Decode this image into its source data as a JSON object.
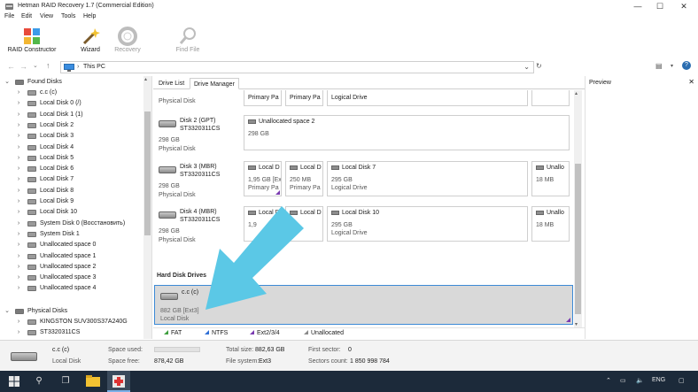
{
  "window": {
    "title": "Hetman RAID Recovery 1.7 (Commercial Edition)",
    "controls": [
      "—",
      "☐",
      "✕"
    ]
  },
  "menu": [
    "File",
    "Edit",
    "View",
    "Tools",
    "Help"
  ],
  "toolbar": {
    "raid_constructor": "RAID Constructor",
    "wizard": "Wizard",
    "recovery": "Recovery",
    "find_file": "Find File"
  },
  "address": {
    "path": "This PC"
  },
  "tree": {
    "found_disks_label": "Found Disks",
    "found_disks": [
      "c.c (c)",
      "Local Disk 0 (/)",
      "Local Disk 1 (1)",
      "Local Disk 2",
      "Local Disk 3",
      "Local Disk 4",
      "Local Disk 5",
      "Local Disk 6",
      "Local Disk 7",
      "Local Disk 8",
      "Local Disk 9",
      "Local Disk 10",
      "System Disk 0 (Восстановить)",
      "System Disk 1",
      "Unallocated space 0",
      "Unallocated space 1",
      "Unallocated space 2",
      "Unallocated space 3",
      "Unallocated space 4"
    ],
    "physical_disks_label": "Physical Disks",
    "physical_disks": [
      "KINGSTON SUV300S37A240G",
      "ST3320311CS"
    ]
  },
  "tabs": {
    "drive_list": "Drive List",
    "drive_manager": "Drive Manager"
  },
  "drive_manager": {
    "top_row": {
      "type": "Physical Disk",
      "partitions": [
        {
          "name": "",
          "type": "Primary Pa"
        },
        {
          "name": "",
          "type": "Primary Pa"
        },
        {
          "name": "",
          "type": "Logical Drive"
        },
        {
          "name": "",
          "type": ""
        }
      ]
    },
    "disk2": {
      "name": "Disk 2 (GPT)",
      "serial": "ST3320311CS",
      "size": "298 GB",
      "type": "Physical Disk",
      "partition": {
        "name": "Unallocated space 2",
        "size": "298 GB"
      }
    },
    "disk3": {
      "name": "Disk 3 (MBR)",
      "serial": "ST3320311CS",
      "size": "298 GB",
      "type": "Physical Disk",
      "partitions": [
        {
          "name": "Local D",
          "size": "1,95 GB [Ex",
          "type": "Primary Pa"
        },
        {
          "name": "Local D",
          "size": "250 MB",
          "type": "Primary Pa"
        },
        {
          "name": "Local Disk 7",
          "size": "295 GB",
          "type": "Logical Drive"
        },
        {
          "name": "Unallo",
          "size": "18 MB",
          "type": ""
        }
      ]
    },
    "disk4": {
      "name": "Disk 4 (MBR)",
      "serial": "ST3320311CS",
      "size": "298 GB",
      "type": "Physical Disk",
      "partitions": [
        {
          "name": "Local D",
          "size": "1,9",
          "type": ""
        },
        {
          "name": "Local D",
          "size": "",
          "type": ""
        },
        {
          "name": "Local Disk 10",
          "size": "295 GB",
          "type": "Logical Drive"
        },
        {
          "name": "Unallo",
          "size": "18 MB",
          "type": ""
        }
      ]
    },
    "hdd_section_label": "Hard Disk Drives",
    "selected": {
      "name": "c.c (c)",
      "size": "882 GB [Ext3]",
      "type": "Local Disk"
    }
  },
  "legend": [
    {
      "label": "FAT",
      "color": "#3f9f3f"
    },
    {
      "label": "NTFS",
      "color": "#2f6fd6"
    },
    {
      "label": "Ext2/3/4",
      "color": "#7a3bb0"
    },
    {
      "label": "Unallocated",
      "color": "#8a8a8a"
    }
  ],
  "preview": {
    "title": "Preview",
    "close": "✕"
  },
  "status": {
    "name": "c.c (c)",
    "kind": "Local Disk",
    "space_used_label": "Space used:",
    "space_free_label": "Space free:",
    "space_free_value": "878,42 GB",
    "total_size_label": "Total size:",
    "total_size_value": "882,63 GB",
    "file_system_label": "File system:",
    "file_system_value": "Ext3",
    "first_sector_label": "First sector:",
    "first_sector_value": "0",
    "sectors_count_label": "Sectors count:",
    "sectors_count_value": "1 850 998 784"
  },
  "taskbar": {
    "lang": "ENG"
  },
  "colors": {
    "selection_border": "#3c8ad6",
    "arrow": "#5bc8e6",
    "taskbar": "#1c2a3a"
  }
}
